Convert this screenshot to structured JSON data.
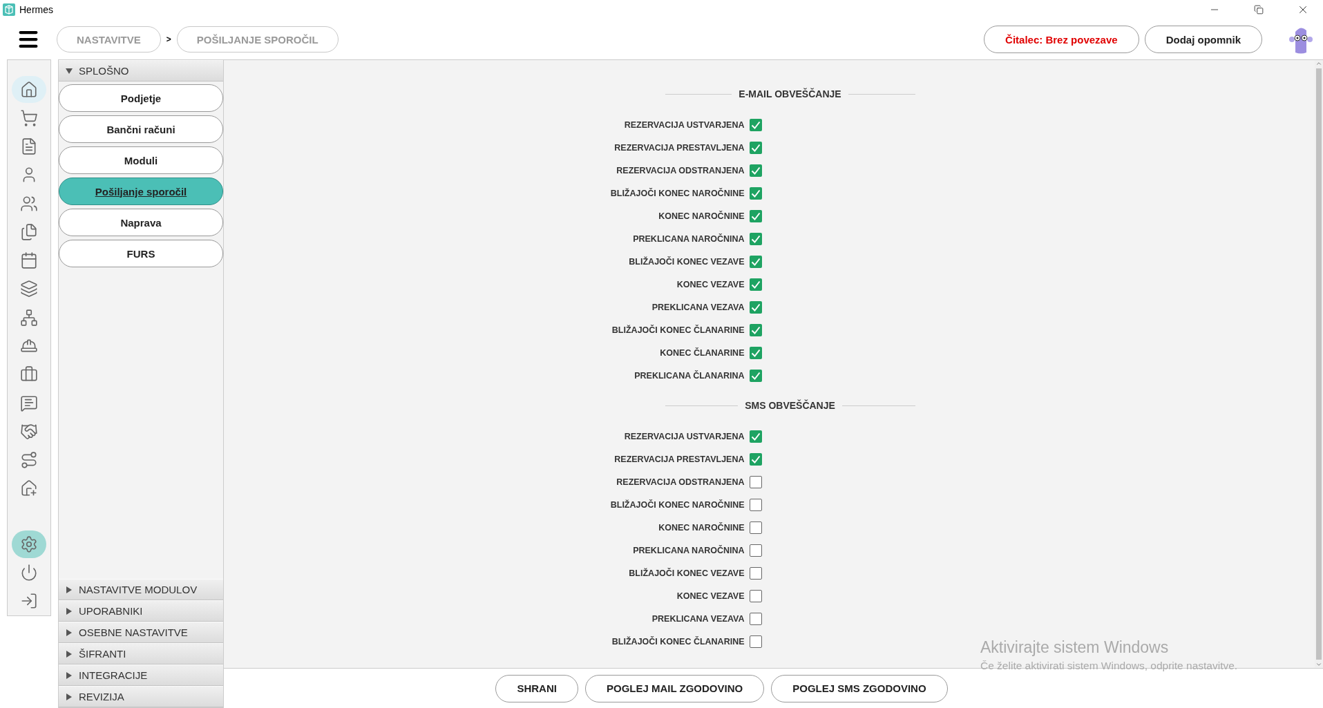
{
  "window": {
    "title": "Hermes"
  },
  "breadcrumbs": [
    {
      "label": "NASTAVITVE"
    },
    {
      "label": "POŠILJANJE SPOROČIL"
    }
  ],
  "breadcrumb_separator": ">",
  "top_buttons": [
    {
      "label": "Čitalec: Brez povezave",
      "kind": "alert"
    },
    {
      "label": "Dodaj opomnik",
      "kind": "normal"
    }
  ],
  "rail": {
    "top": [
      {
        "selected": false,
        "hovered": true
      },
      {
        "selected": false,
        "hovered": false
      },
      {
        "selected": false,
        "hovered": false
      },
      {
        "selected": false,
        "hovered": false
      },
      {
        "selected": false,
        "hovered": false
      },
      {
        "selected": false,
        "hovered": false
      },
      {
        "selected": false,
        "hovered": false
      },
      {
        "selected": false,
        "hovered": false
      },
      {
        "selected": false,
        "hovered": false
      },
      {
        "selected": false,
        "hovered": false
      },
      {
        "selected": false,
        "hovered": false
      },
      {
        "selected": false,
        "hovered": false
      },
      {
        "selected": false,
        "hovered": false
      },
      {
        "selected": false,
        "hovered": false
      },
      {
        "selected": false,
        "hovered": false
      }
    ],
    "bottom": [
      {
        "selected": true,
        "hovered": false
      },
      {
        "selected": false,
        "hovered": false
      },
      {
        "selected": false,
        "hovered": false
      }
    ]
  },
  "sidebar": {
    "sections": [
      {
        "title": "SPLOŠNO",
        "expanded": true,
        "items": [
          {
            "label": "Podjetje",
            "selected": false
          },
          {
            "label": "Bančni računi",
            "selected": false
          },
          {
            "label": "Moduli",
            "selected": false
          },
          {
            "label": "Pošiljanje sporočil",
            "selected": true
          },
          {
            "label": "Naprava",
            "selected": false
          },
          {
            "label": "FURS",
            "selected": false
          }
        ]
      },
      {
        "title": "NASTAVITVE MODULOV",
        "expanded": false
      },
      {
        "title": "UPORABNIKI",
        "expanded": false
      },
      {
        "title": "OSEBNE NASTAVITVE",
        "expanded": false
      },
      {
        "title": "ŠIFRANTI",
        "expanded": false
      },
      {
        "title": "INTEGRACIJE",
        "expanded": false
      },
      {
        "title": "REVIZIJA",
        "expanded": false
      }
    ]
  },
  "sections": [
    {
      "title": "E-MAIL OBVEŠČANJE",
      "options": [
        {
          "label": "REZERVACIJA USTVARJENA",
          "checked": true
        },
        {
          "label": "REZERVACIJA PRESTAVLJENA",
          "checked": true
        },
        {
          "label": "REZERVACIJA ODSTRANJENA",
          "checked": true
        },
        {
          "label": "BLIŽAJOČI KONEC NAROČNINE",
          "checked": true
        },
        {
          "label": "KONEC NAROČNINE",
          "checked": true
        },
        {
          "label": "PREKLICANA NAROČNINA",
          "checked": true
        },
        {
          "label": "BLIŽAJOČI KONEC VEZAVE",
          "checked": true
        },
        {
          "label": "KONEC VEZAVE",
          "checked": true
        },
        {
          "label": "PREKLICANA VEZAVA",
          "checked": true
        },
        {
          "label": "BLIŽAJOČI KONEC ČLANARINE",
          "checked": true
        },
        {
          "label": "KONEC ČLANARINE",
          "checked": true
        },
        {
          "label": "PREKLICANA ČLANARINA",
          "checked": true
        }
      ]
    },
    {
      "title": "SMS OBVEŠČANJE",
      "options": [
        {
          "label": "REZERVACIJA USTVARJENA",
          "checked": true
        },
        {
          "label": "REZERVACIJA PRESTAVLJENA",
          "checked": true
        },
        {
          "label": "REZERVACIJA ODSTRANJENA",
          "checked": false
        },
        {
          "label": "BLIŽAJOČI KONEC NAROČNINE",
          "checked": false
        },
        {
          "label": "KONEC NAROČNINE",
          "checked": false
        },
        {
          "label": "PREKLICANA NAROČNINA",
          "checked": false
        },
        {
          "label": "BLIŽAJOČI KONEC VEZAVE",
          "checked": false
        },
        {
          "label": "KONEC VEZAVE",
          "checked": false
        },
        {
          "label": "PREKLICANA VEZAVA",
          "checked": false
        },
        {
          "label": "BLIŽAJOČI KONEC ČLANARINE",
          "checked": false
        }
      ]
    }
  ],
  "bottom_buttons": [
    {
      "label": "SHRANI"
    },
    {
      "label": "POGLEJ MAIL ZGODOVINO"
    },
    {
      "label": "POGLEJ SMS ZGODOVINO"
    }
  ],
  "windows_activation": {
    "title": "Aktivirajte sistem Windows",
    "text": "Če želite aktivirati sistem Windows, odprite nastavitve."
  }
}
